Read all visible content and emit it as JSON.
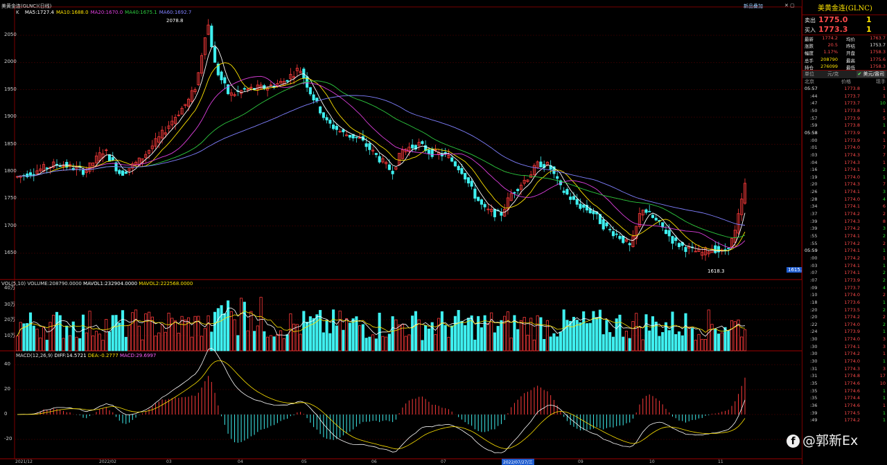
{
  "window": {
    "title": "美黄金连(GLNC)(日线)"
  },
  "toolbar": {
    "add_label": "新品叠加",
    "close_icon": "close-icon"
  },
  "main_pane": {
    "k_label": "K",
    "ma_labels": [
      {
        "text": "MA5:1727.4",
        "color": "#ffffff"
      },
      {
        "text": "MA10:1688.0",
        "color": "#ffe400"
      },
      {
        "text": "MA20:1670.0",
        "color": "#e040e0"
      },
      {
        "text": "MA40:1675.1",
        "color": "#2ecc40"
      },
      {
        "text": "MA60:1692.7",
        "color": "#8080ff"
      }
    ],
    "yaxis": [
      "2050",
      "2000",
      "1950",
      "1900",
      "1850",
      "1800",
      "1750",
      "1700",
      "1650"
    ],
    "high_marker": "2078.8",
    "low_marker": "1618.3",
    "price_tag": "1615.3"
  },
  "vol_pane": {
    "label": "VOL(5,10)",
    "values_text": "VOLUME:208790.0000",
    "mavol1": "MAVOL1:232904.0000",
    "mavol2": "MAVOL2:222568.0000",
    "yaxis": [
      "40万",
      "30万",
      "20万",
      "10万"
    ]
  },
  "macd_pane": {
    "label": "MACD(12,26,9)",
    "diff": "DIFF:14.5721",
    "dea": "DEA:-0.2777",
    "macd": "MACD:29.6997",
    "yaxis": [
      "40",
      "20",
      "0",
      "-20"
    ]
  },
  "xaxis": [
    "2021/12",
    "2022/02",
    "03",
    "04",
    "05",
    "06",
    "07",
    "08",
    "09",
    "10",
    "11"
  ],
  "xaxis_highlight": "2022/07/27/三",
  "chart_data": {
    "type": "candlestick",
    "title": "美黄金连(GLNC)",
    "ylim": [
      1618.3,
      2078.8
    ],
    "candles_approx_ohlc_note": "",
    "segments": [
      {
        "from": "2021/12",
        "close": 1800
      },
      {
        "from": "2022/02",
        "close": 1820
      },
      {
        "from": "03",
        "close": 2078.8
      },
      {
        "from": "04",
        "close": 1950
      },
      {
        "from": "05",
        "close": 1850
      },
      {
        "from": "06",
        "close": 1820
      },
      {
        "from": "07",
        "close": 1700
      },
      {
        "from": "08",
        "close": 1810
      },
      {
        "from": "09",
        "close": 1660
      },
      {
        "from": "10",
        "close": 1640
      },
      {
        "from": "11",
        "close": 1775
      }
    ]
  },
  "panel": {
    "title": "美黄金连(GLNC)",
    "sell_label": "卖出",
    "sell_price": "1775.0",
    "sell_qty": "1",
    "buy_label": "买入",
    "buy_price": "1773.3",
    "buy_qty": "1",
    "quote_rows": [
      {
        "l1": "最新",
        "v1": "1774.2",
        "l2": "均价",
        "v2": "1763.7"
      },
      {
        "l1": "涨跌",
        "v1": "20.5",
        "l2": "昨结",
        "v2": "1753.7"
      },
      {
        "l1": "幅度",
        "v1": "1.17%",
        "l2": "开盘",
        "v2": "1758.3"
      },
      {
        "l1": "总手",
        "v1": "208790",
        "l2": "最高",
        "v2": "1775.6"
      },
      {
        "l1": "持仓",
        "v1": "276099",
        "l2": "最低",
        "v2": "1758.3"
      }
    ],
    "unit_label": "单位",
    "unit_value": "元/克",
    "unit_alt": "美元/盎司",
    "header": {
      "time": "北京",
      "price": "价格",
      "vol": "现手"
    },
    "trades": [
      {
        "t": "05:57",
        "p": "1773.8",
        "v": "1",
        "c": "red"
      },
      {
        "t": ":44",
        "p": "1773.7",
        "v": "1",
        "c": "red"
      },
      {
        "t": ":47",
        "p": "1773.7",
        "v": "10",
        "c": "green"
      },
      {
        "t": ":50",
        "p": "1773.8",
        "v": "1",
        "c": "red"
      },
      {
        "t": ":57",
        "p": "1773.9",
        "v": "5",
        "c": "red"
      },
      {
        "t": ":59",
        "p": "1773.8",
        "v": "1",
        "c": "green"
      },
      {
        "t": "05:58",
        "p": "1773.9",
        "v": "4",
        "c": "red"
      },
      {
        "t": ":00",
        "p": "1773.9",
        "v": "1",
        "c": "red"
      },
      {
        "t": ":01",
        "p": "1774.0",
        "v": "7",
        "c": "red"
      },
      {
        "t": ":03",
        "p": "1774.3",
        "v": "7",
        "c": "red"
      },
      {
        "t": ":04",
        "p": "1774.3",
        "v": "1",
        "c": "red"
      },
      {
        "t": ":16",
        "p": "1774.1",
        "v": "2",
        "c": "green"
      },
      {
        "t": ":19",
        "p": "1774.0",
        "v": "1",
        "c": "green"
      },
      {
        "t": ":20",
        "p": "1774.3",
        "v": "7",
        "c": "red"
      },
      {
        "t": ":26",
        "p": "1774.1",
        "v": "3",
        "c": "green"
      },
      {
        "t": ":28",
        "p": "1774.0",
        "v": "4",
        "c": "green"
      },
      {
        "t": ":34",
        "p": "1774.1",
        "v": "6",
        "c": "red"
      },
      {
        "t": ":37",
        "p": "1774.2",
        "v": "2",
        "c": "red"
      },
      {
        "t": ":39",
        "p": "1774.3",
        "v": "8",
        "c": "red"
      },
      {
        "t": ":39",
        "p": "1774.2",
        "v": "3",
        "c": "green"
      },
      {
        "t": ":55",
        "p": "1774.1",
        "v": "2",
        "c": "green"
      },
      {
        "t": ":55",
        "p": "1774.2",
        "v": "2",
        "c": "red"
      },
      {
        "t": "05:59",
        "p": "1774.1",
        "v": "1",
        "c": "green"
      },
      {
        "t": ":00",
        "p": "1774.2",
        "v": "1",
        "c": "red"
      },
      {
        "t": ":03",
        "p": "1774.1",
        "v": "1",
        "c": "green"
      },
      {
        "t": ":07",
        "p": "1774.1",
        "v": "2",
        "c": "green"
      },
      {
        "t": ":07",
        "p": "1773.9",
        "v": "2",
        "c": "green"
      },
      {
        "t": ":09",
        "p": "1773.7",
        "v": "4",
        "c": "green"
      },
      {
        "t": ":10",
        "p": "1774.0",
        "v": "2",
        "c": "red"
      },
      {
        "t": ":18",
        "p": "1773.6",
        "v": "1",
        "c": "green"
      },
      {
        "t": ":20",
        "p": "1773.5",
        "v": "2",
        "c": "green"
      },
      {
        "t": ":20",
        "p": "1774.2",
        "v": "2",
        "c": "red"
      },
      {
        "t": ":22",
        "p": "1774.0",
        "v": "2",
        "c": "green"
      },
      {
        "t": ":24",
        "p": "1773.9",
        "v": "1",
        "c": "green"
      },
      {
        "t": ":30",
        "p": "1774.0",
        "v": "3",
        "c": "red"
      },
      {
        "t": ":30",
        "p": "1774.1",
        "v": "3",
        "c": "red"
      },
      {
        "t": ":30",
        "p": "1774.2",
        "v": "1",
        "c": "red"
      },
      {
        "t": ":30",
        "p": "1774.0",
        "v": "1",
        "c": "green"
      },
      {
        "t": ":31",
        "p": "1774.3",
        "v": "3",
        "c": "red"
      },
      {
        "t": ":31",
        "p": "1774.8",
        "v": "17",
        "c": "red"
      },
      {
        "t": ":35",
        "p": "1774.6",
        "v": "10",
        "c": "red"
      },
      {
        "t": ":35",
        "p": "1774.6",
        "v": "1",
        "c": "green"
      },
      {
        "t": ":35",
        "p": "1774.4",
        "v": "1",
        "c": "green"
      },
      {
        "t": ":36",
        "p": "1774.6",
        "v": "1",
        "c": "red"
      },
      {
        "t": ":39",
        "p": "1774.5",
        "v": "1",
        "c": "green"
      },
      {
        "t": ":49",
        "p": "1774.2",
        "v": "1",
        "c": "green"
      }
    ]
  },
  "watermark": {
    "text": "@郭新Ex",
    "icon": "facebook-icon"
  },
  "colors": {
    "up": "#ff3b3b",
    "down": "#3ff0f0",
    "grid": "#5a0000",
    "bg": "#000000"
  }
}
